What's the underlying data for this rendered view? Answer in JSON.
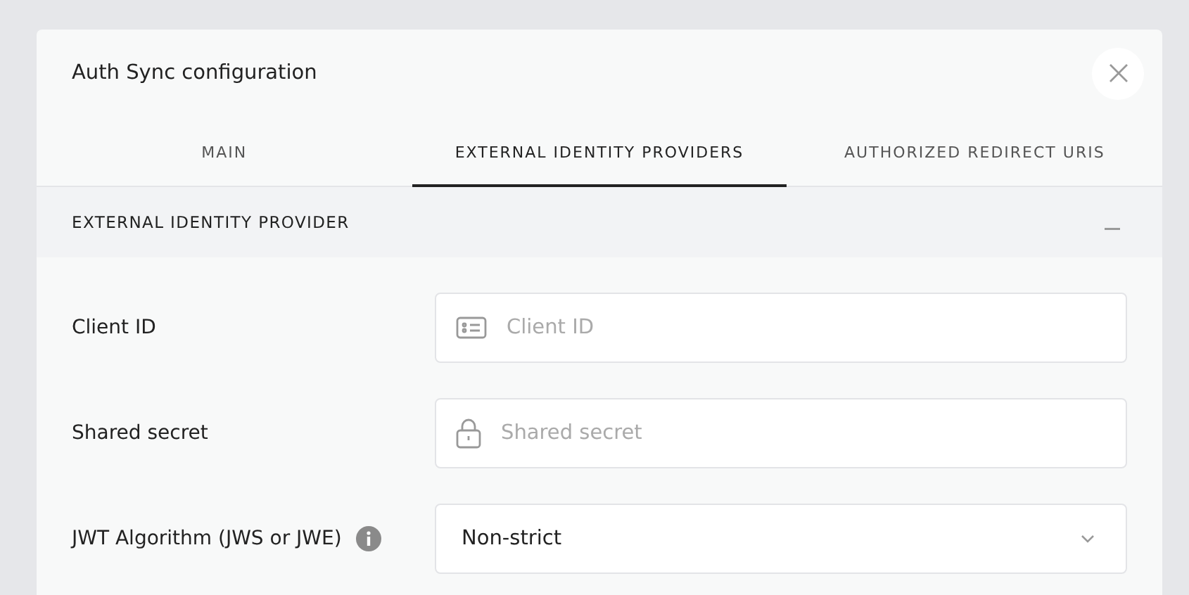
{
  "dialog": {
    "title": "Auth Sync configuration"
  },
  "tabs": [
    {
      "label": "MAIN",
      "selected": false
    },
    {
      "label": "EXTERNAL IDENTITY PROVIDERS",
      "selected": true
    },
    {
      "label": "AUTHORIZED REDIRECT URIS",
      "selected": false
    }
  ],
  "section": {
    "title": "EXTERNAL IDENTITY PROVIDER",
    "expanded": true
  },
  "fields": [
    {
      "kind": "text",
      "label": "Client ID",
      "placeholder": "Client ID",
      "info": false
    },
    {
      "kind": "secret",
      "label": "Shared secret",
      "placeholder": "Shared secret",
      "info": false
    },
    {
      "kind": "select",
      "label": "JWT Algorithm (JWS or JWE)",
      "value": "Non-strict",
      "info": true
    }
  ]
}
